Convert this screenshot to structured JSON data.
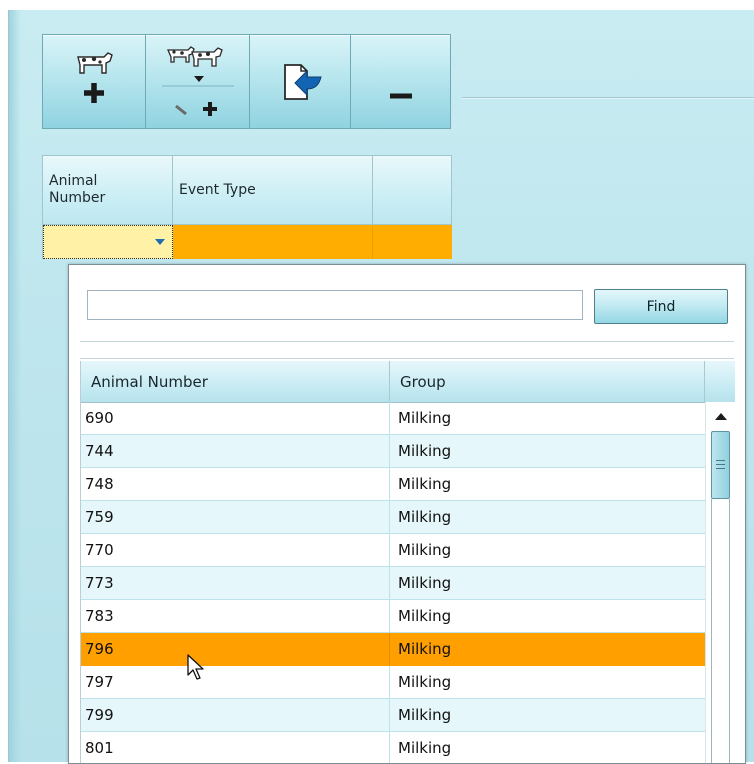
{
  "toolbar": {
    "buttons": [
      {
        "name": "add-animal-button",
        "icon": "cow-plus-icon"
      },
      {
        "name": "bulk-edit-animals-button",
        "icon": "herd-edit-plus-icon"
      },
      {
        "name": "import-button",
        "icon": "import-arrow-icon"
      },
      {
        "name": "remove-button",
        "icon": "minus-icon"
      }
    ]
  },
  "event_grid": {
    "columns": [
      "Animal\nNumber",
      "Event Type",
      ""
    ],
    "row_colors": {
      "editing_cell": "#fff2a6",
      "row_highlight": "#ffad00"
    }
  },
  "lookup": {
    "search_value": "",
    "find_label": "Find",
    "columns": [
      "Animal Number",
      "Group"
    ],
    "rows": [
      {
        "animal_number": "690",
        "group": "Milking"
      },
      {
        "animal_number": "744",
        "group": "Milking"
      },
      {
        "animal_number": "748",
        "group": "Milking"
      },
      {
        "animal_number": "759",
        "group": "Milking"
      },
      {
        "animal_number": "770",
        "group": "Milking"
      },
      {
        "animal_number": "773",
        "group": "Milking"
      },
      {
        "animal_number": "783",
        "group": "Milking"
      },
      {
        "animal_number": "796",
        "group": "Milking"
      },
      {
        "animal_number": "797",
        "group": "Milking"
      },
      {
        "animal_number": "799",
        "group": "Milking"
      },
      {
        "animal_number": "801",
        "group": "Milking"
      }
    ],
    "selected_index": 7,
    "colors": {
      "selected_row": "#ffa000",
      "alt_row": "#e6f7fb",
      "accent": "#8fd3e0"
    }
  }
}
